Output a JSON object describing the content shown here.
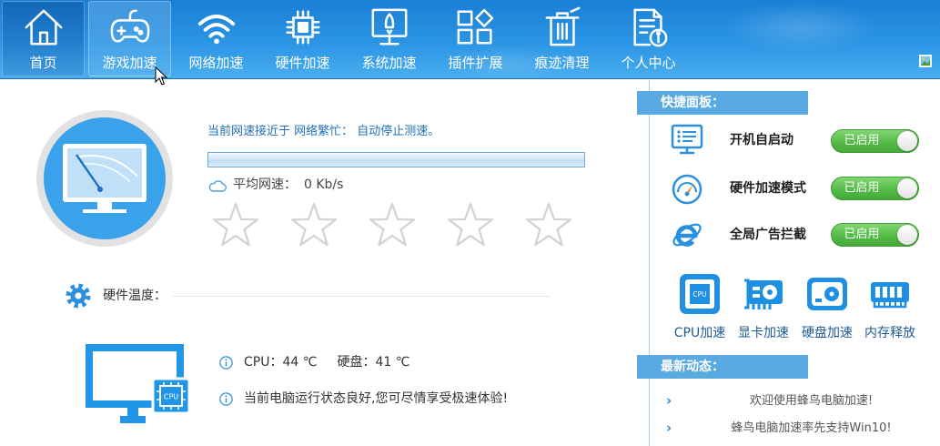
{
  "theme": {
    "nav_top": "#1a7fd5",
    "nav_bottom": "#4aaeef",
    "accent": "#2196e8",
    "text_blue": "#1f6fb8",
    "panel_header": "#5aaae2",
    "toggle_on": "#52b944",
    "star_outline": "#d2d2d2"
  },
  "nav": {
    "items": [
      {
        "label": "首页",
        "icon": "home-icon",
        "selected": true
      },
      {
        "label": "游戏加速",
        "icon": "gamepad-icon",
        "hover": true
      },
      {
        "label": "网络加速",
        "icon": "wifi-icon"
      },
      {
        "label": "硬件加速",
        "icon": "chip-icon"
      },
      {
        "label": "系统加速",
        "icon": "rocket-monitor-icon"
      },
      {
        "label": "插件扩展",
        "icon": "plugin-grid-icon"
      },
      {
        "label": "痕迹清理",
        "icon": "trash-icon"
      },
      {
        "label": "个人中心",
        "icon": "profile-document-icon"
      }
    ],
    "skin_icon": "skin-icon"
  },
  "speed_test": {
    "gauge_icon": "speed-monitor-icon",
    "status_text": "当前网速接近于 网络繁忙： 自动停止测速。",
    "avg_icon": "cloud-icon",
    "avg_label": "平均网速：",
    "avg_value": "0 Kb/s",
    "rating": 0,
    "rating_max": 5
  },
  "hardware": {
    "section_icon": "gear-icon",
    "section_title": "硬件温度：",
    "monitor_icon": "computer-cpu-icon",
    "badge_text": "CPU",
    "cpu_label": "CPU：",
    "cpu_value": "44 ℃",
    "disk_label": "硬盘：",
    "disk_value": "41 ℃",
    "status_text": "当前电脑运行状态良好,您可尽情享受极速体验!"
  },
  "quick_panel": {
    "title": "快捷面板：",
    "toggles": [
      {
        "label": "开机自启动",
        "state": "已启用",
        "on": true,
        "icon": "startup-list-icon"
      },
      {
        "label": "硬件加速模式",
        "state": "已启用",
        "on": true,
        "icon": "speedometer-icon"
      },
      {
        "label": "全局广告拦截",
        "state": "已启用",
        "on": true,
        "icon": "ie-browser-icon"
      }
    ],
    "tools": [
      {
        "label": "CPU加速",
        "icon": "cpu-icon",
        "icon_text": "CPU"
      },
      {
        "label": "显卡加速",
        "icon": "graphics-card-icon"
      },
      {
        "label": "硬盘加速",
        "icon": "hard-disk-icon"
      },
      {
        "label": "内存释放",
        "icon": "memory-icon"
      }
    ]
  },
  "news": {
    "title": "最新动态：",
    "items": [
      "欢迎使用蜂鸟电脑加速!",
      "蜂鸟电脑加速率先支持Win10!"
    ]
  }
}
